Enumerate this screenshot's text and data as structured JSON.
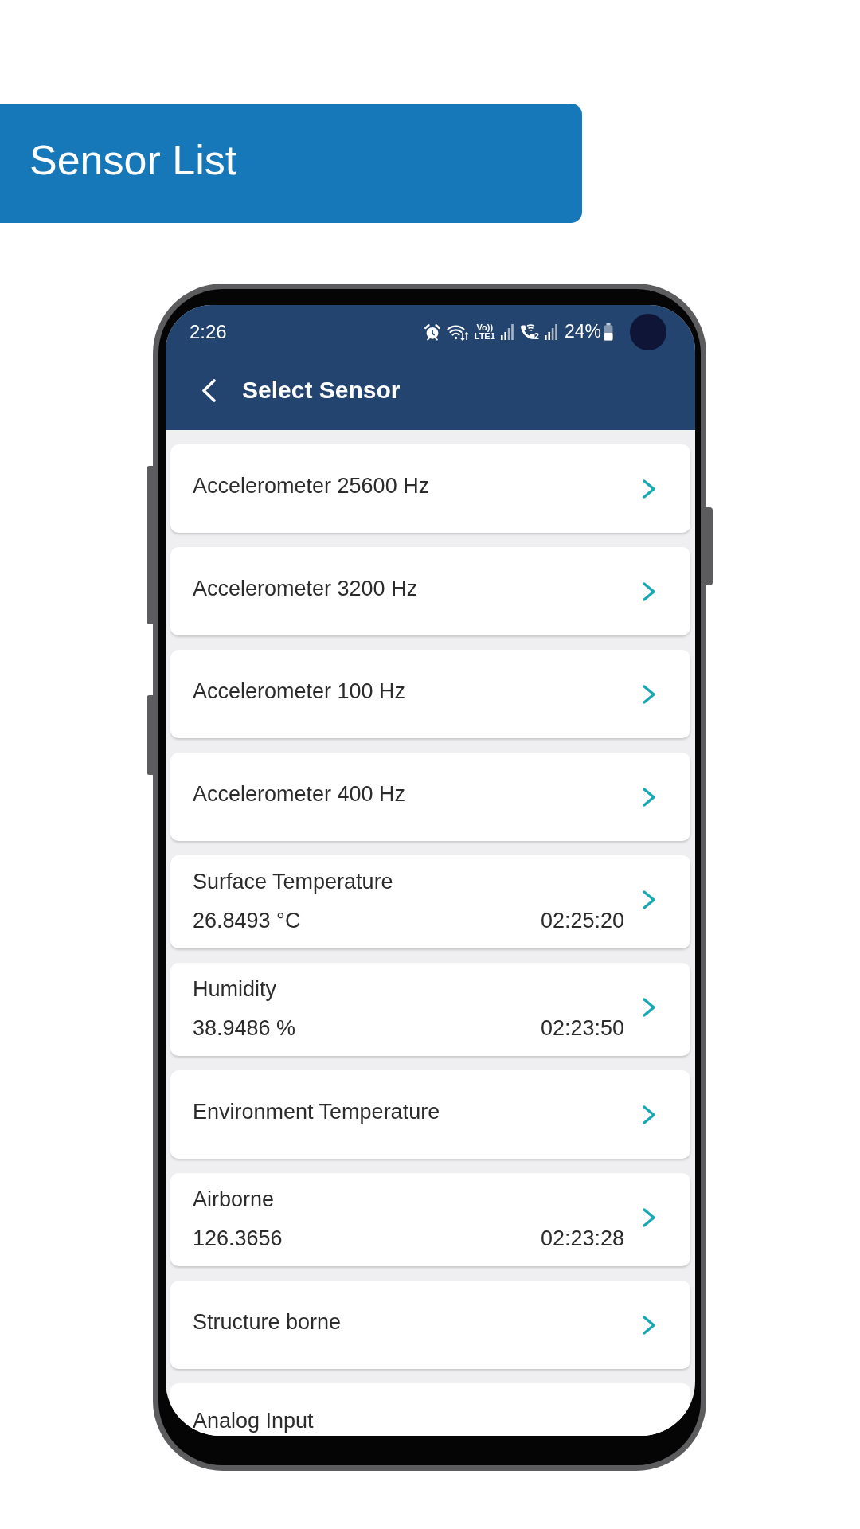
{
  "banner": {
    "title": "Sensor List"
  },
  "status_bar": {
    "time": "2:26",
    "network_tag": [
      "Vo))",
      "LTE1"
    ],
    "sim_label": "2",
    "battery": "24%"
  },
  "app_bar": {
    "title": "Select Sensor"
  },
  "sensors": [
    {
      "kind": "single",
      "name": "Accelerometer 25600 Hz"
    },
    {
      "kind": "single",
      "name": "Accelerometer 3200 Hz"
    },
    {
      "kind": "single",
      "name": "Accelerometer 100 Hz"
    },
    {
      "kind": "single",
      "name": "Accelerometer 400 Hz"
    },
    {
      "kind": "reading",
      "name": "Surface Temperature",
      "value": "26.8493 °C",
      "time": "02:25:20"
    },
    {
      "kind": "reading",
      "name": "Humidity",
      "value": "38.9486 %",
      "time": "02:23:50"
    },
    {
      "kind": "single",
      "name": "Environment Temperature"
    },
    {
      "kind": "reading",
      "name": "Airborne",
      "value": "126.3656",
      "time": "02:23:28"
    },
    {
      "kind": "single",
      "name": "Structure borne"
    },
    {
      "kind": "partial",
      "name": "Analog Input"
    }
  ]
}
